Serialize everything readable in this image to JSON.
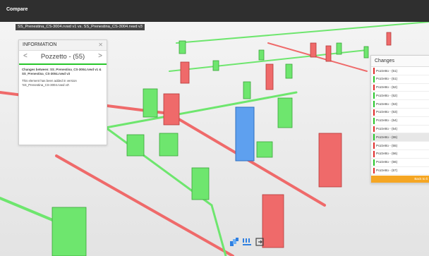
{
  "app": {
    "title": "Compare"
  },
  "file_compare_label": "SS_Prenestina_CS-3004.rvwd v1 vs. SS_Prenestina_CS-3004.rvwd v3",
  "info": {
    "title": "INFORMATION",
    "close_icon": "close-icon",
    "element_name": "Pozzetto - (55)",
    "prev_icon": "chevron-left-icon",
    "next_icon": "chevron-right-icon",
    "changes_between": "Changes between: SS_Prenestina_CS-3004.rvwd v1 & SS_Prenestina_CS-3004.rvwd v3",
    "message": "This element has been added in version 'SS_Prenestina_CS-3004.rvwd v3'."
  },
  "changes": {
    "title": "Changes",
    "footer": "Back to li",
    "items": [
      {
        "label": "Pozzetto - (51)",
        "status": "removed"
      },
      {
        "label": "Pozzetto - (51)",
        "status": "added"
      },
      {
        "label": "Pozzetto - (52)",
        "status": "removed"
      },
      {
        "label": "Pozzetto - (52)",
        "status": "added"
      },
      {
        "label": "Pozzetto - (53)",
        "status": "added"
      },
      {
        "label": "Pozzetto - (53)",
        "status": "removed"
      },
      {
        "label": "Pozzetto - (54)",
        "status": "added"
      },
      {
        "label": "Pozzetto - (54)",
        "status": "removed"
      },
      {
        "label": "Pozzetto - (55)",
        "status": "added",
        "selected": true
      },
      {
        "label": "Pozzetto - (55)",
        "status": "removed"
      },
      {
        "label": "Pozzetto - (56)",
        "status": "removed"
      },
      {
        "label": "Pozzetto - (56)",
        "status": "added"
      },
      {
        "label": "Pozzetto - (57)",
        "status": "removed"
      }
    ]
  },
  "colors": {
    "added": "#27c62a",
    "removed": "#e02b2b",
    "accent": "#f5a623",
    "selected": "#2f7fe0"
  },
  "toolbar": {
    "icons": [
      "compare-models-icon",
      "level-icon",
      "exit-icon"
    ]
  }
}
